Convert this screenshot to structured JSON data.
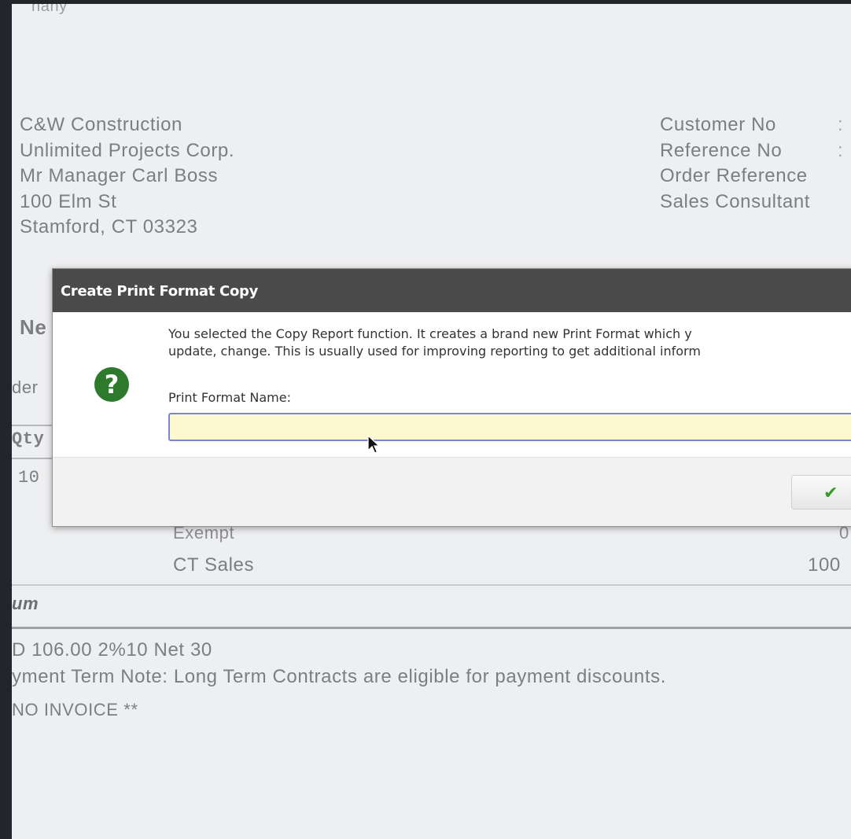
{
  "report": {
    "company_cut": "nany",
    "address_lines": [
      "C&W Construction",
      "Unlimited Projects Corp.",
      "Mr Manager Carl Boss",
      "100 Elm St",
      "Stamford, CT 03323"
    ],
    "meta_labels": [
      "Customer No",
      "Reference No",
      "Order Reference",
      "Sales Consultant"
    ],
    "meta_colons": [
      ":",
      ":"
    ],
    "left_fragments": {
      "heading": "Ne",
      "order": "der",
      "qty_header": "Qty",
      "qty_value": "10"
    },
    "tax_rows": [
      {
        "label": "Exempt",
        "value": "0"
      },
      {
        "label": "CT Sales",
        "value": "100"
      }
    ],
    "sum_label": "um",
    "total_line": "D  106.00  2%10 Net 30",
    "payment_note": "yment Term Note: Long Term Contracts are eligible for payment discounts.",
    "no_invoice": "NO INVOICE **"
  },
  "dialog": {
    "title": "Create Print Format Copy",
    "message_line1": "You selected the Copy Report function. It creates a brand new Print Format which y",
    "message_line2": "update, change. This is usually used for improving reporting to get additional inform",
    "field_label": "Print Format Name:",
    "field_value": "",
    "ok_icon": "checkmark-icon",
    "icon": "question-icon",
    "colors": {
      "title_bar": "#4a4a4a",
      "input_bg": "#fdf8cf",
      "input_border": "#7b84d6",
      "icon_green": "#2d7a2d",
      "check_green": "#3a9a2a"
    }
  }
}
